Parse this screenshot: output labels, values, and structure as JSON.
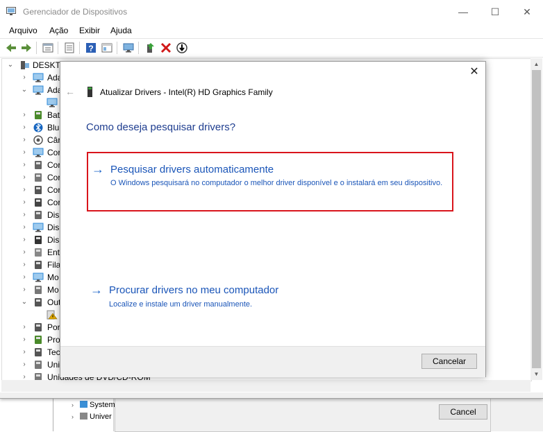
{
  "window": {
    "title": "Gerenciador de Dispositivos",
    "controls": {
      "minimize": "—",
      "maximize": "☐",
      "close": "✕"
    }
  },
  "menu": [
    "Arquivo",
    "Ação",
    "Exibir",
    "Ajuda"
  ],
  "toolbar": {
    "icons": [
      "back-icon",
      "forward-icon",
      "properties-icon",
      "list-icon",
      "help-icon",
      "view-icon",
      "monitor-icon",
      "update-driver-icon",
      "uninstall-icon",
      "disable-icon"
    ]
  },
  "tree": {
    "root": "DESKTO",
    "items": [
      {
        "label": "Ada",
        "chev": "›",
        "icon": "network-icon",
        "color": "#2d8ad8"
      },
      {
        "label": "Ada",
        "chev": "⌄",
        "icon": "display-adapter-icon",
        "color": "#2d8ad8"
      },
      {
        "label": "",
        "chev": "",
        "icon": "display-icon",
        "color": "#2d8ad8"
      },
      {
        "label": "Bat",
        "chev": "›",
        "icon": "battery-icon",
        "color": "#4a8a2a"
      },
      {
        "label": "Blu",
        "chev": "›",
        "icon": "bluetooth-icon",
        "color": "#1565c0"
      },
      {
        "label": "Câr",
        "chev": "›",
        "icon": "camera-icon",
        "color": "#555555"
      },
      {
        "label": "Cor",
        "chev": "›",
        "icon": "computer-icon",
        "color": "#2d8ad8"
      },
      {
        "label": "Cor",
        "chev": "›",
        "icon": "controller-icon",
        "color": "#666666"
      },
      {
        "label": "Cor",
        "chev": "›",
        "icon": "audio-icon",
        "color": "#777777"
      },
      {
        "label": "Cor",
        "chev": "›",
        "icon": "storage-icon",
        "color": "#555555"
      },
      {
        "label": "Cor",
        "chev": "›",
        "icon": "usb-icon",
        "color": "#444444"
      },
      {
        "label": "Disp",
        "chev": "›",
        "icon": "hid-icon",
        "color": "#666666"
      },
      {
        "label": "Disp",
        "chev": "›",
        "icon": "system-icon",
        "color": "#2d8ad8"
      },
      {
        "label": "Disp",
        "chev": "›",
        "icon": "portable-icon",
        "color": "#333333"
      },
      {
        "label": "Ent",
        "chev": "›",
        "icon": "audio-io-icon",
        "color": "#888888"
      },
      {
        "label": "Fila",
        "chev": "›",
        "icon": "print-queue-icon",
        "color": "#555555"
      },
      {
        "label": "Mo",
        "chev": "›",
        "icon": "monitor-icon",
        "color": "#2d8ad8"
      },
      {
        "label": "Mo",
        "chev": "›",
        "icon": "mouse-icon",
        "color": "#777777"
      },
      {
        "label": "Out",
        "chev": "⌄",
        "icon": "other-devices-icon",
        "color": "#555555"
      },
      {
        "label": "",
        "chev": "",
        "icon": "warning-icon",
        "color": "#e0a800"
      },
      {
        "label": "Por",
        "chev": "›",
        "icon": "port-icon",
        "color": "#555555"
      },
      {
        "label": "Pro",
        "chev": "›",
        "icon": "processor-icon",
        "color": "#4a8a2a"
      },
      {
        "label": "Tec",
        "chev": "›",
        "icon": "keyboard-icon",
        "color": "#555555"
      },
      {
        "label": "Uni",
        "chev": "›",
        "icon": "disk-icon",
        "color": "#777777"
      },
      {
        "label": "Unidades de DVD/CD-ROM",
        "chev": "›",
        "icon": "dvd-icon",
        "color": "#777777"
      }
    ]
  },
  "dialog": {
    "title": "Atualizar Drivers - Intel(R) HD Graphics Family",
    "heading": "Como deseja pesquisar drivers?",
    "option1": {
      "arrow": "→",
      "title": "Pesquisar drivers automaticamente",
      "desc": "O Windows pesquisará no computador o melhor driver disponível e o instalará em seu dispositivo."
    },
    "option2": {
      "arrow": "→",
      "title": "Procurar drivers no meu computador",
      "desc": "Localize e instale um driver manualmente."
    },
    "cancel": "Cancelar",
    "close": "✕",
    "back": "←"
  },
  "background_window": {
    "rows": [
      "System",
      "Univer"
    ],
    "cancel": "Cancel"
  },
  "colors": {
    "link": "#1a55b8",
    "heading": "#1e3d8f",
    "highlight": "#d9141b"
  }
}
